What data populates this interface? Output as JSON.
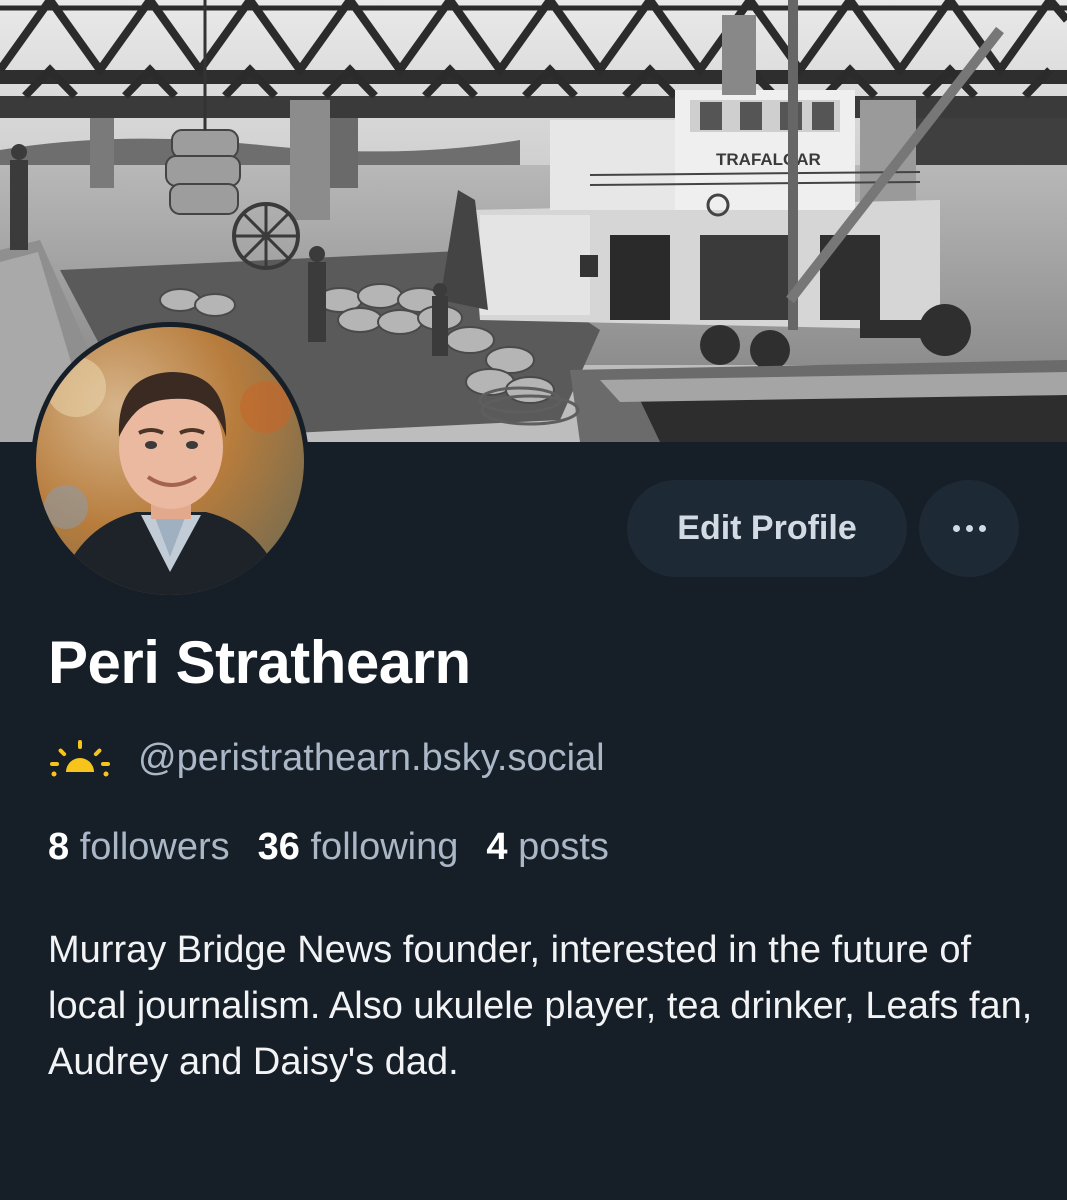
{
  "banner": {
    "image": "black-and-white photo of paddle steamer Trafalgar at a wharf under a truss bridge",
    "boat_name": "TRAFALGAR"
  },
  "avatar": {
    "alt": "profile photo of a man in a dark jacket"
  },
  "actions": {
    "edit_profile_label": "Edit Profile",
    "more_icon": "ellipsis-icon"
  },
  "profile": {
    "display_name": "Peri Strathearn",
    "handle": "@peristrathearn.bsky.social",
    "handle_icon": "sunrise-icon",
    "stats": {
      "followers_count": "8",
      "followers_label": "followers",
      "following_count": "36",
      "following_label": "following",
      "posts_count": "4",
      "posts_label": "posts"
    },
    "bio": "Murray Bridge News founder, interested in the future of local journalism. Also ukulele player, tea drinker, Leafs fan, Audrey and Daisy's dad."
  },
  "colors": {
    "background": "#161e27",
    "button_bg": "#1e2936",
    "muted_text": "#aab7c6",
    "sunrise_yellow": "#f7c41c"
  }
}
